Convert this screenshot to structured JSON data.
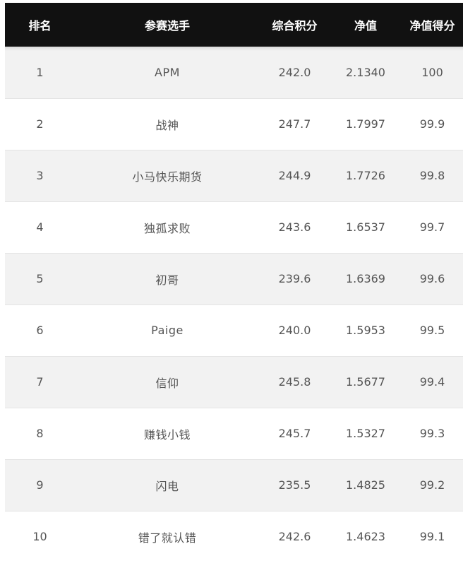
{
  "table": {
    "headers": {
      "rank": "排名",
      "name": "参赛选手",
      "score": "综合积分",
      "nav": "净值",
      "nav_score": "净值得分"
    },
    "rows": [
      {
        "rank": "1",
        "name": "APM",
        "score": "242.0",
        "nav": "2.1340",
        "nav_score": "100"
      },
      {
        "rank": "2",
        "name": "战神",
        "score": "247.7",
        "nav": "1.7997",
        "nav_score": "99.9"
      },
      {
        "rank": "3",
        "name": "小马快乐期货",
        "score": "244.9",
        "nav": "1.7726",
        "nav_score": "99.8"
      },
      {
        "rank": "4",
        "name": "独孤求败",
        "score": "243.6",
        "nav": "1.6537",
        "nav_score": "99.7"
      },
      {
        "rank": "5",
        "name": "初哥",
        "score": "239.6",
        "nav": "1.6369",
        "nav_score": "99.6"
      },
      {
        "rank": "6",
        "name": "Paige",
        "score": "240.0",
        "nav": "1.5953",
        "nav_score": "99.5"
      },
      {
        "rank": "7",
        "name": "信仰",
        "score": "245.8",
        "nav": "1.5677",
        "nav_score": "99.4"
      },
      {
        "rank": "8",
        "name": "赚钱小钱",
        "score": "245.7",
        "nav": "1.5327",
        "nav_score": "99.3"
      },
      {
        "rank": "9",
        "name": "闪电",
        "score": "235.5",
        "nav": "1.4825",
        "nav_score": "99.2"
      },
      {
        "rank": "10",
        "name": "错了就认错",
        "score": "242.6",
        "nav": "1.4623",
        "nav_score": "99.1"
      }
    ]
  },
  "colors": {
    "header_bg": "#111111",
    "header_text": "#ffffff",
    "row_odd_bg": "#f2f2f2",
    "row_even_bg": "#ffffff",
    "cell_text": "#555555"
  }
}
